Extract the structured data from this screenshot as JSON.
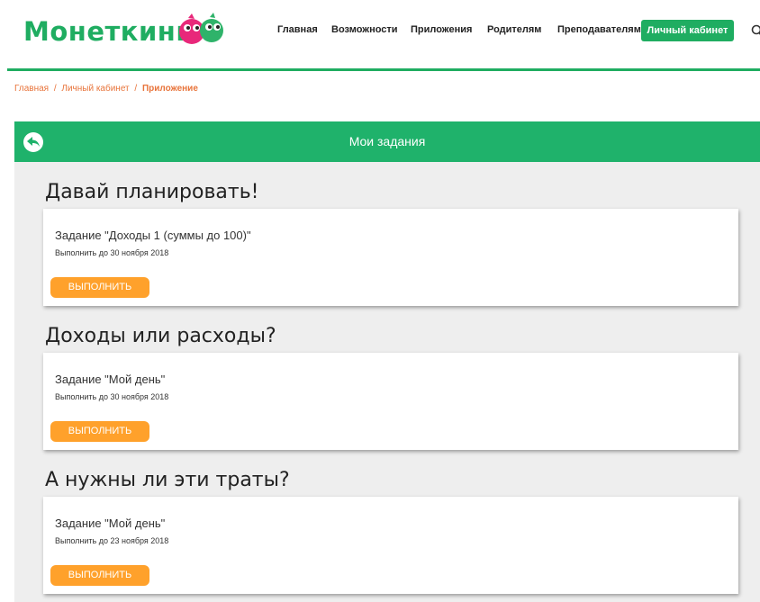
{
  "header": {
    "logo_text": "Монеткины",
    "nav": [
      {
        "label": "Главная"
      },
      {
        "label": "Возможности"
      },
      {
        "label": "Приложения"
      },
      {
        "label": "Родителям"
      },
      {
        "label": "Преподавателям"
      }
    ],
    "cabinet_label": "Личный кабинет",
    "search_icon": "search-icon"
  },
  "breadcrumb": {
    "items": [
      "Главная",
      "Личный кабинет"
    ],
    "current": "Приложение",
    "separator": "/"
  },
  "panel": {
    "title": "Мои задания",
    "back_icon": "back-arrow-icon"
  },
  "sections": [
    {
      "title": "Давай планировать!",
      "task": "Задание \"Доходы 1 (суммы до 100)\"",
      "due": "Выполнить до 30 ноября 2018",
      "button": "ВЫПОЛНИТЬ"
    },
    {
      "title": "Доходы или расходы?",
      "task": "Задание \"Мой день\"",
      "due": "Выполнить до 30 ноября 2018",
      "button": "ВЫПОЛНИТЬ"
    },
    {
      "title": "А нужны ли эти траты?",
      "task": "Задание \"Мой день\"",
      "due": "Выполнить до 23 ноября 2018",
      "button": "ВЫПОЛНИТЬ"
    }
  ],
  "colors": {
    "brand_green": "#1fad61",
    "header_green": "#1fb26b",
    "button_orange": "#ffa12b",
    "breadcrumb_orange": "#e8743b",
    "panel_bg": "#eeeeee"
  }
}
